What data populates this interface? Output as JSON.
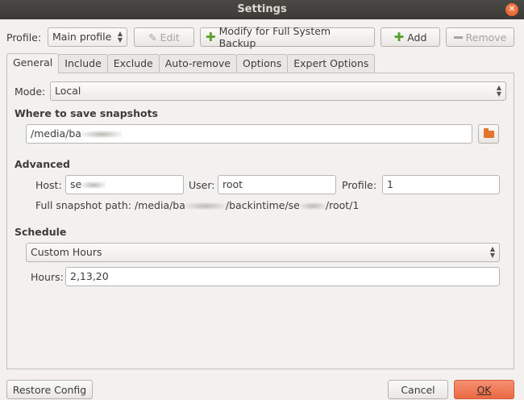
{
  "window": {
    "title": "Settings"
  },
  "toolbar": {
    "profile_label": "Profile:",
    "profile_value": "Main profile",
    "edit_label": "Edit",
    "modify_label": "Modify for Full System Backup",
    "add_label": "Add",
    "remove_label": "Remove"
  },
  "tabs": [
    {
      "label": "General"
    },
    {
      "label": "Include"
    },
    {
      "label": "Exclude"
    },
    {
      "label": "Auto-remove"
    },
    {
      "label": "Options"
    },
    {
      "label": "Expert Options"
    }
  ],
  "general": {
    "mode_label": "Mode:",
    "mode_value": "Local",
    "where_heading": "Where to save snapshots",
    "path_visible": "/media/ba",
    "advanced_heading": "Advanced",
    "host_label": "Host:",
    "host_visible": "se",
    "user_label": "User:",
    "user_value": "root",
    "profile_label": "Profile:",
    "profile_value": "1",
    "full_path_label": "Full snapshot path:",
    "full_path_start": "/media/ba",
    "full_path_mid": "/backintime/se",
    "full_path_end": "/root/1",
    "schedule_heading": "Schedule",
    "schedule_value": "Custom Hours",
    "hours_label": "Hours:",
    "hours_value": "2,13,20"
  },
  "footer": {
    "restore_label": "Restore Config",
    "cancel_label": "Cancel",
    "ok_label": "OK"
  },
  "colors": {
    "accent": "#ea6a45",
    "titlebar": "#3b3a37",
    "folder": "#e5732c",
    "plus": "#5ca12d"
  }
}
